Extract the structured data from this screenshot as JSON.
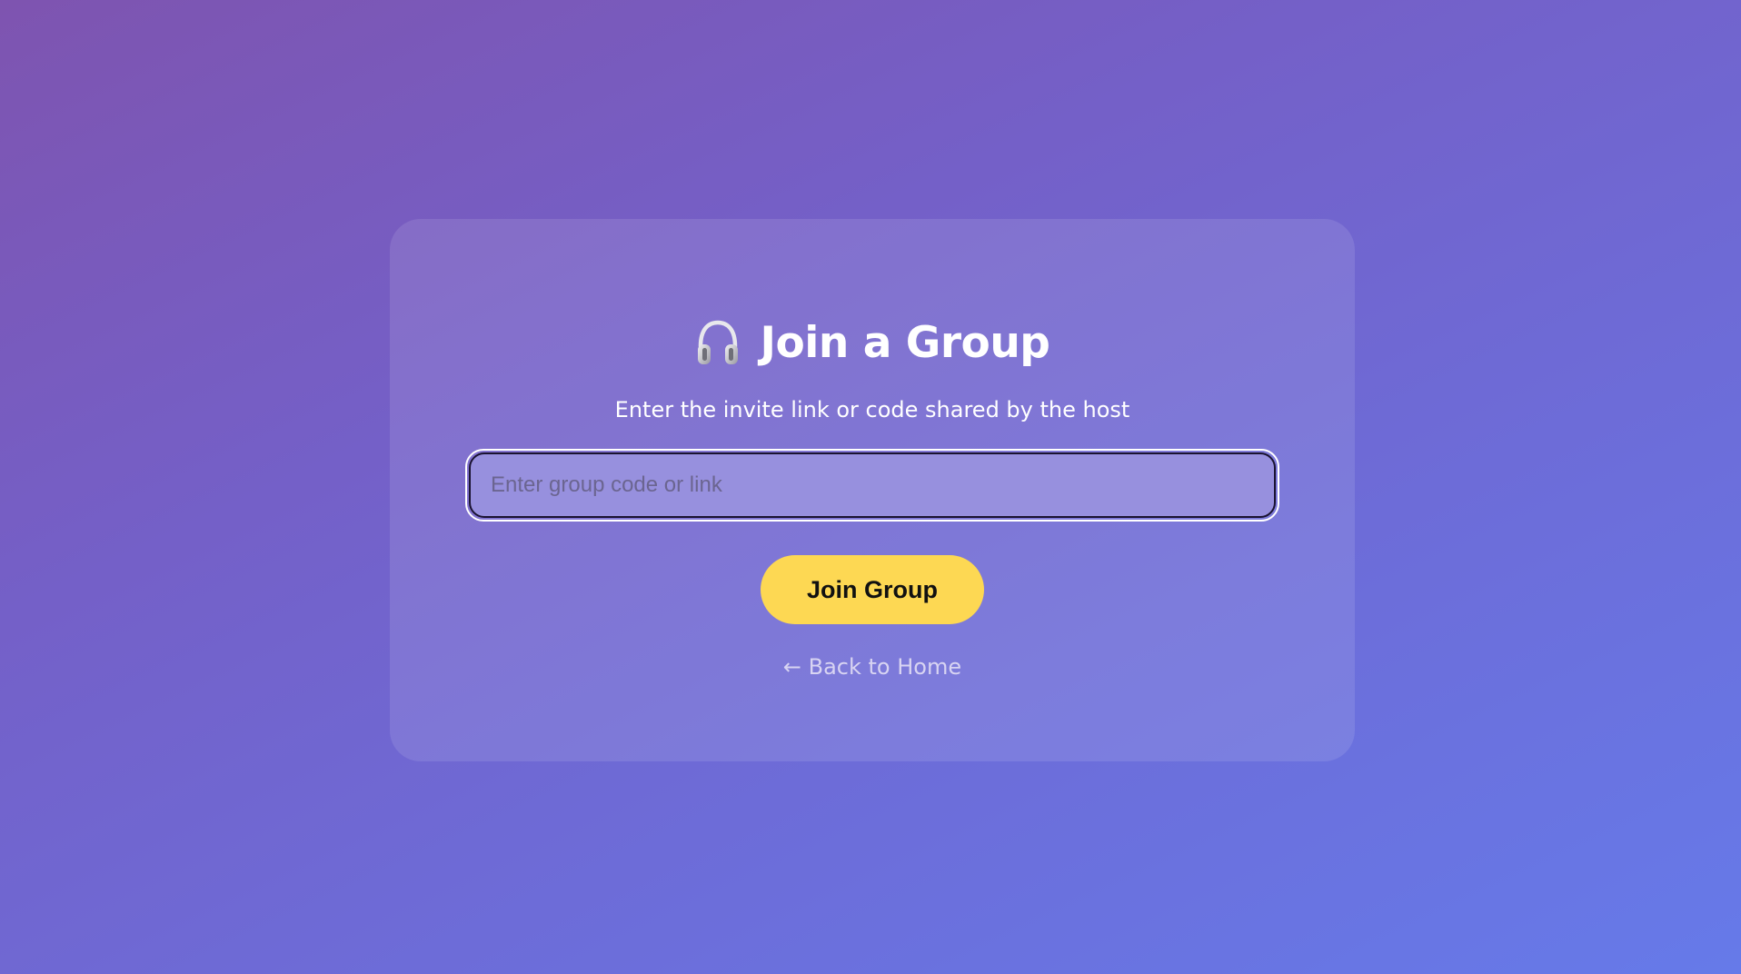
{
  "page": {
    "icon": "headphones-icon",
    "title": "Join a Group",
    "subtitle": "Enter the invite link or code shared by the host"
  },
  "form": {
    "code_input": {
      "placeholder": "Enter group code or link",
      "value": ""
    },
    "join_button_label": "Join Group"
  },
  "navigation": {
    "back_link_label": "← Back to Home"
  },
  "colors": {
    "background_start": "#7e54b0",
    "background_end": "#667ae9",
    "button_accent": "#fdd853",
    "input_background": "#9790de"
  }
}
